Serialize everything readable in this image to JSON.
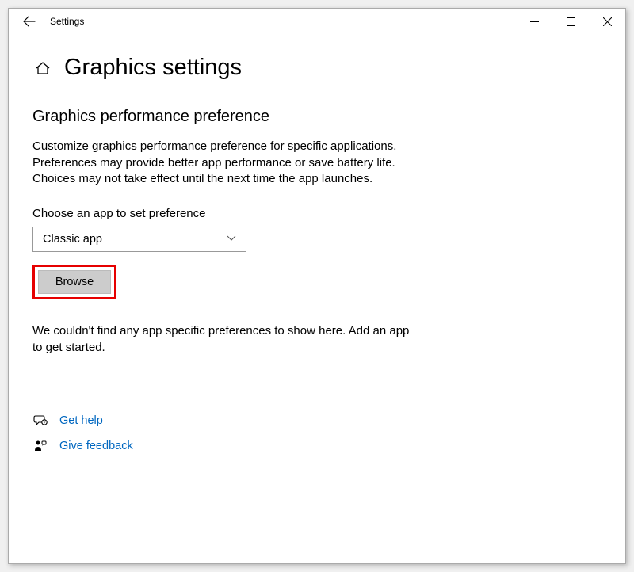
{
  "window": {
    "title": "Settings"
  },
  "page": {
    "title": "Graphics settings"
  },
  "section": {
    "heading": "Graphics performance preference",
    "desc_line1": "Customize graphics performance preference for specific applications.",
    "desc_line2": "Preferences may provide better app performance or save battery life.",
    "desc_line3": "Choices may not take effect until the next time the app launches."
  },
  "chooser": {
    "label": "Choose an app to set preference",
    "selected": "Classic app",
    "browse_label": "Browse"
  },
  "empty_state": {
    "line1": "We couldn't find any app specific preferences to show here. Add an app",
    "line2": "to get started."
  },
  "links": {
    "help": "Get help",
    "feedback": "Give feedback"
  }
}
